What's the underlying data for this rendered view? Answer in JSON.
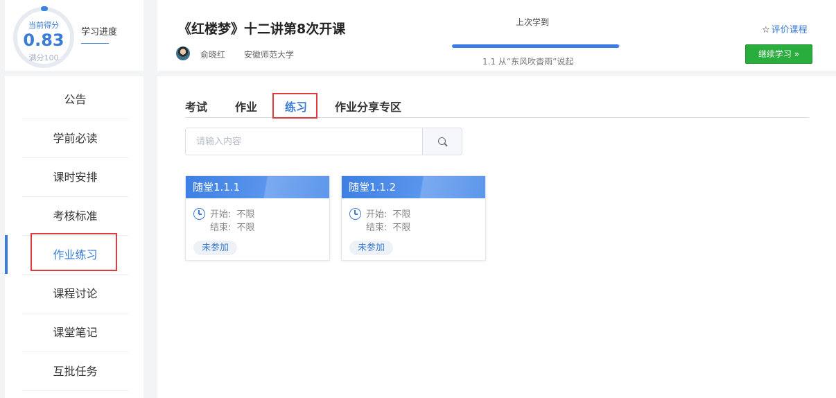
{
  "score": {
    "label": "当前得分",
    "value": "0.83",
    "full": "满分100"
  },
  "progress": {
    "title": "学习进度"
  },
  "course": {
    "title": "《红楼梦》十二讲第8次开课",
    "teacher": "俞晓红",
    "school": "安徽师范大学",
    "last_label": "上次学到",
    "last_lesson": "1.1 从“东风吹杳雨”说起",
    "progress_fraction": 0.99,
    "rate_label": "评价课程",
    "continue_label": "继续学习 »"
  },
  "sidebar": {
    "items": [
      {
        "label": "公告"
      },
      {
        "label": "学前必读"
      },
      {
        "label": "课时安排"
      },
      {
        "label": "考核标准"
      },
      {
        "label": "作业练习"
      },
      {
        "label": "课程讨论"
      },
      {
        "label": "课堂笔记"
      },
      {
        "label": "互批任务"
      }
    ]
  },
  "tabs": [
    {
      "label": "考试"
    },
    {
      "label": "作业"
    },
    {
      "label": "练习"
    },
    {
      "label": "作业分享专区"
    }
  ],
  "search": {
    "placeholder": "请输入内容"
  },
  "cards": [
    {
      "title": "随堂1.1.1",
      "start_label": "开始:",
      "start_value": "不限",
      "end_label": "结束:",
      "end_value": "不限",
      "status": "未参加"
    },
    {
      "title": "随堂1.1.2",
      "start_label": "开始:",
      "start_value": "不限",
      "end_label": "结束:",
      "end_value": "不限",
      "status": "未参加"
    }
  ],
  "colors": {
    "accent": "#3a7bd5",
    "continue": "#29ad3d",
    "highlight_box": "#e0393e"
  }
}
